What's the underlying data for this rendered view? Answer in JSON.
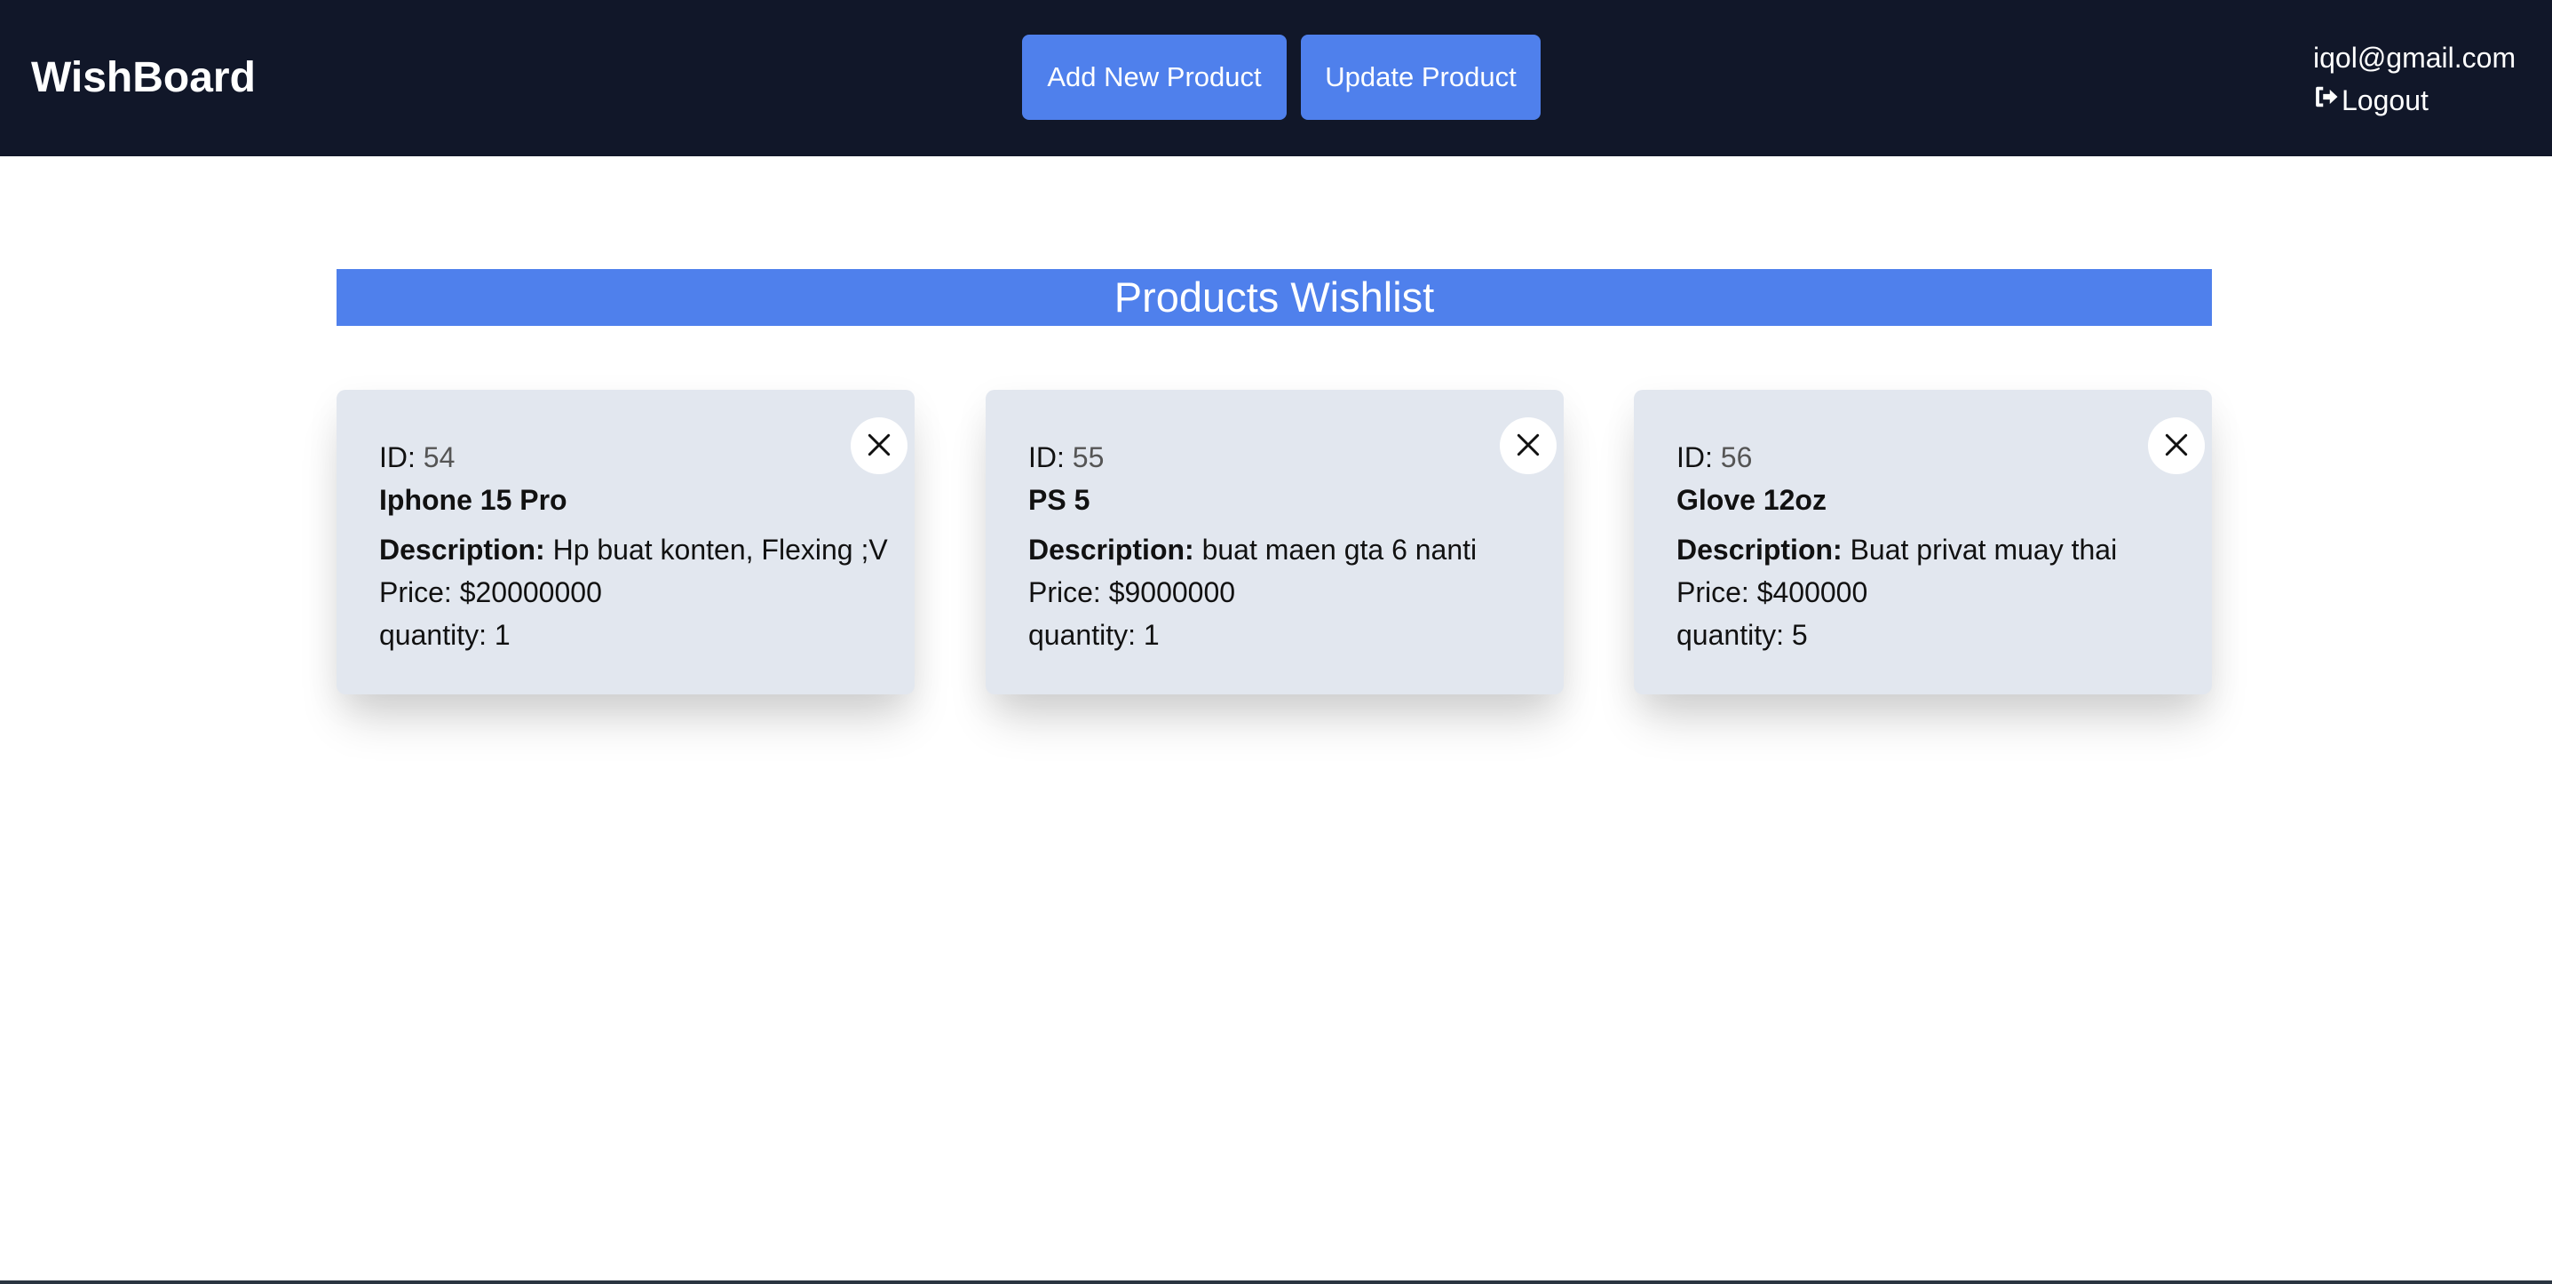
{
  "header": {
    "brand": "WishBoard",
    "add_button": "Add New Product",
    "update_button": "Update Product",
    "user_email": "iqol@gmail.com",
    "logout_label": "Logout"
  },
  "main": {
    "title": "Products Wishlist",
    "labels": {
      "id": "ID:",
      "description": "Description:",
      "price": "Price:",
      "quantity": "quantity:"
    },
    "products": [
      {
        "id": "54",
        "name": "Iphone 15 Pro",
        "description": "Hp buat konten, Flexing ;V",
        "price": "$20000000",
        "quantity": "1"
      },
      {
        "id": "55",
        "name": "PS 5",
        "description": "buat maen gta 6 nanti",
        "price": "$9000000",
        "quantity": "1"
      },
      {
        "id": "56",
        "name": "Glove 12oz",
        "description": "Buat privat muay thai",
        "price": "$400000",
        "quantity": "5"
      }
    ]
  },
  "colors": {
    "navbar_bg": "#111729",
    "accent": "#4f80ec",
    "card_bg": "#e2e7ef"
  },
  "icons": {
    "logout": "sign-out-icon",
    "remove": "close-icon"
  }
}
